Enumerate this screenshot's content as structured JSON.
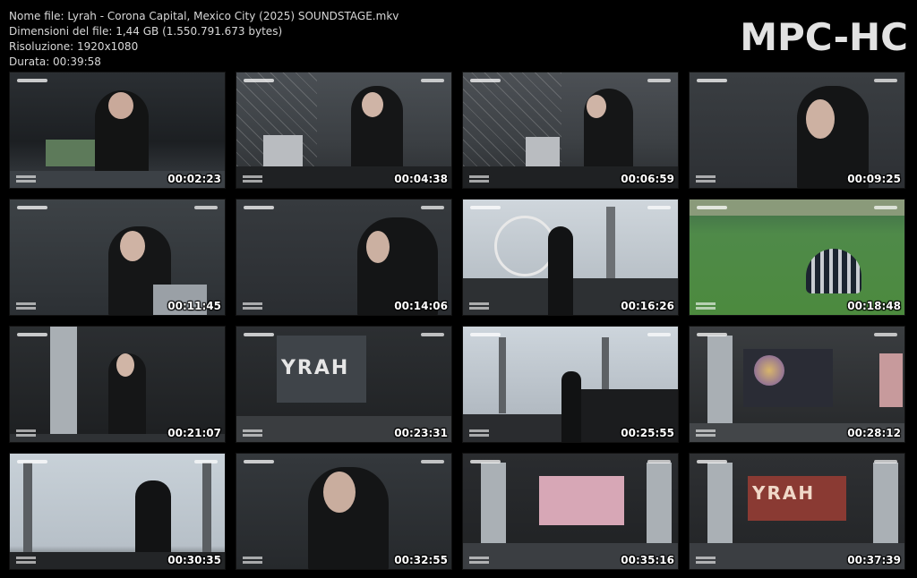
{
  "file_info": {
    "name": "Nome file: Lyrah - Corona Capital, Mexico City (2025) SOUNDSTAGE.mkv",
    "size": "Dimensioni del file: 1,44 GB (1.550.791.673 bytes)",
    "resolution": "Risoluzione: 1920x1080",
    "duration": "Durata: 00:39:58"
  },
  "logo": "MPC-HC",
  "thumbnails": [
    {
      "time": "00:02:23"
    },
    {
      "time": "00:04:38"
    },
    {
      "time": "00:06:59"
    },
    {
      "time": "00:09:25"
    },
    {
      "time": "00:11:45"
    },
    {
      "time": "00:14:06"
    },
    {
      "time": "00:16:26"
    },
    {
      "time": "00:18:48"
    },
    {
      "time": "00:21:07"
    },
    {
      "time": "00:23:31",
      "banner": "YRAH"
    },
    {
      "time": "00:25:55"
    },
    {
      "time": "00:28:12"
    },
    {
      "time": "00:30:35"
    },
    {
      "time": "00:32:55"
    },
    {
      "time": "00:35:16"
    },
    {
      "time": "00:37:39",
      "banner": "YRAH"
    }
  ]
}
